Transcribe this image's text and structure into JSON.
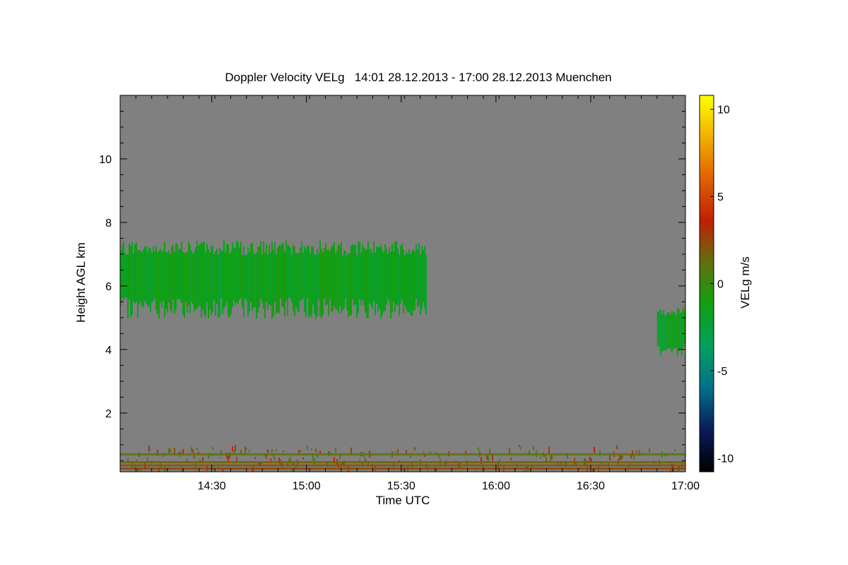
{
  "chart_data": {
    "type": "heatmap",
    "title": "Doppler Velocity VELg   14:01 28.12.2013 - 17:00 28.12.2013 Muenchen",
    "xlabel": "Time UTC",
    "ylabel": "Height AGL km",
    "colorbar_label": "VELg m/s",
    "xlim": [
      "14:01",
      "17:00"
    ],
    "xlim_minutes": [
      841,
      1020
    ],
    "x_ticks": [
      {
        "label": "14:30",
        "minutes": 870
      },
      {
        "label": "15:00",
        "minutes": 900
      },
      {
        "label": "15:30",
        "minutes": 930
      },
      {
        "label": "16:00",
        "minutes": 960
      },
      {
        "label": "16:30",
        "minutes": 990
      },
      {
        "label": "17:00",
        "minutes": 1020
      }
    ],
    "ylim": [
      0.15,
      12.0
    ],
    "y_ticks": [
      {
        "label": "2",
        "value": 2
      },
      {
        "label": "4",
        "value": 4
      },
      {
        "label": "6",
        "value": 6
      },
      {
        "label": "8",
        "value": 8
      },
      {
        "label": "10",
        "value": 10
      }
    ],
    "colorbar_range": [
      -10.8,
      10.8
    ],
    "colorbar_ticks": [
      {
        "label": "10",
        "value": 10
      },
      {
        "label": "5",
        "value": 5
      },
      {
        "label": "0",
        "value": 0
      },
      {
        "label": "-5",
        "value": -5
      },
      {
        "label": "-10",
        "value": -10
      }
    ],
    "colormap": [
      "#000000",
      "#0a1a5a",
      "#00708a",
      "#00a060",
      "#10a010",
      "#607010",
      "#c02000",
      "#e06000",
      "#f0b000",
      "#ffff00"
    ],
    "background_color": "#808080",
    "features": [
      {
        "name": "ice cloud",
        "t_start": 841,
        "t_end": 938,
        "z_bottom": 5.3,
        "z_top": 7.2,
        "velocity": -1.5
      },
      {
        "name": "cloud onset",
        "t_start": 1011,
        "t_end": 1020,
        "z_bottom": 4.0,
        "z_top": 5.2,
        "velocity": -1.8
      },
      {
        "name": "boundary layer",
        "t_start": 841,
        "t_end": 1020,
        "z_bottom": 0.2,
        "z_top": 1.0,
        "velocity": 1.0
      }
    ]
  }
}
